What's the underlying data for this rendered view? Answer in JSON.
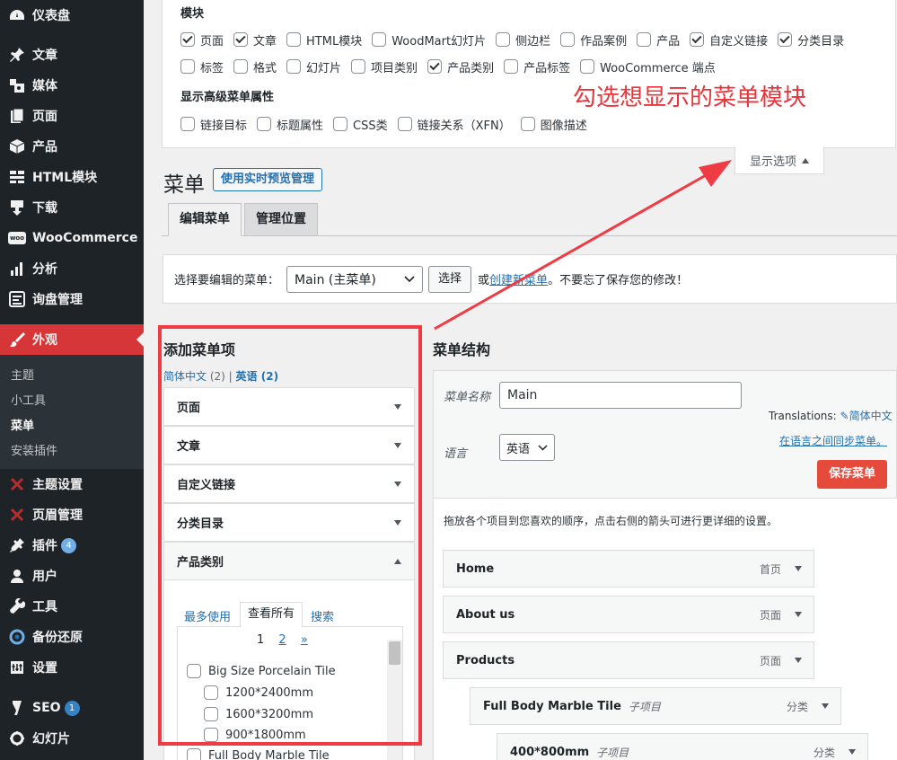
{
  "sidebar": {
    "items": [
      {
        "label": "仪表盘",
        "icon": "dashboard-icon"
      },
      {
        "label": "文章",
        "icon": "pin-icon"
      },
      {
        "label": "媒体",
        "icon": "media-icon"
      },
      {
        "label": "页面",
        "icon": "page-icon"
      },
      {
        "label": "产品",
        "icon": "box-icon"
      },
      {
        "label": "HTML模块",
        "icon": "grid-icon"
      },
      {
        "label": "下载",
        "icon": "download-icon"
      },
      {
        "label": "WooCommerce",
        "icon": "woo-icon"
      },
      {
        "label": "分析",
        "icon": "bar-chart-icon"
      },
      {
        "label": "询盘管理",
        "icon": "inquiry-icon"
      },
      {
        "label": "外观",
        "icon": "brush-icon"
      },
      {
        "label": "主题设置",
        "icon": "x-theme-icon"
      },
      {
        "label": "页眉管理",
        "icon": "x-header-icon"
      },
      {
        "label": "插件",
        "icon": "plugin-icon",
        "badge": "4"
      },
      {
        "label": "用户",
        "icon": "user-icon"
      },
      {
        "label": "工具",
        "icon": "wrench-icon"
      },
      {
        "label": "备份还原",
        "icon": "backup-icon"
      },
      {
        "label": "设置",
        "icon": "settings-icon"
      },
      {
        "label": "SEO",
        "icon": "yoast-icon",
        "badge": "1"
      },
      {
        "label": "幻灯片",
        "icon": "slider-icon"
      }
    ],
    "submenu": [
      "主题",
      "小工具",
      "菜单",
      "安装插件"
    ],
    "woo_logo_text": "woo"
  },
  "screen_options": {
    "modules_heading": "模块",
    "row1": [
      {
        "label": "页面",
        "checked": true
      },
      {
        "label": "文章",
        "checked": true
      },
      {
        "label": "HTML模块",
        "checked": false
      },
      {
        "label": "WoodMart幻灯片",
        "checked": false
      },
      {
        "label": "侧边栏",
        "checked": false
      },
      {
        "label": "作品案例",
        "checked": false
      },
      {
        "label": "产品",
        "checked": false
      },
      {
        "label": "自定义链接",
        "checked": true
      },
      {
        "label": "分类目录",
        "checked": true
      }
    ],
    "row2": [
      {
        "label": "标签",
        "checked": false
      },
      {
        "label": "格式",
        "checked": false
      },
      {
        "label": "幻灯片",
        "checked": false
      },
      {
        "label": "项目类别",
        "checked": false
      },
      {
        "label": "产品类别",
        "checked": true
      },
      {
        "label": "产品标签",
        "checked": false
      },
      {
        "label": "WooCommerce 端点",
        "checked": false
      }
    ],
    "advanced_heading": "显示高级菜单属性",
    "row3": [
      {
        "label": "链接目标",
        "checked": false
      },
      {
        "label": "标题属性",
        "checked": false
      },
      {
        "label": "CSS类",
        "checked": false
      },
      {
        "label": "链接关系（XFN）",
        "checked": false
      },
      {
        "label": "图像描述",
        "checked": false
      }
    ],
    "toggle_label": "显示选项"
  },
  "annotation": "勾选想显示的菜单模块",
  "header": {
    "title": "菜单",
    "live_preview": "使用实时预览管理",
    "tabs": [
      "编辑菜单",
      "管理位置"
    ]
  },
  "select_bar": {
    "prompt": "选择要编辑的菜单：",
    "selected": "Main (主菜单)",
    "select_button": "选择",
    "or_text": "或",
    "create_link": "创建新菜单",
    "reminder": "。不要忘了保存您的修改！"
  },
  "add_items": {
    "title": "添加菜单项",
    "lang_zh": "简体中文",
    "lang_zh_count": "(2)",
    "sep": "|",
    "lang_en": "英语",
    "lang_en_count": "(2)",
    "sections": [
      "页面",
      "文章",
      "自定义链接",
      "分类目录",
      "产品类别"
    ],
    "subtabs": [
      "最多使用",
      "查看所有",
      "搜索"
    ],
    "pager": {
      "current": "1",
      "next_page": "2",
      "next": "»"
    },
    "tree": [
      {
        "label": "Big Size Porcelain Tile",
        "level": 0
      },
      {
        "label": "1200*2400mm",
        "level": 1
      },
      {
        "label": "1600*3200mm",
        "level": 1
      },
      {
        "label": "900*1800mm",
        "level": 1
      },
      {
        "label": "Full Body Marble Tile",
        "level": 0
      }
    ]
  },
  "structure": {
    "title": "菜单结构",
    "name_label": "菜单名称",
    "name_value": "Main",
    "translations_label": "Translations:",
    "translations_link": "简体中文",
    "sync_link": "在语言之间同步菜单。",
    "lang_label": "语言",
    "lang_value": "英语",
    "save_button": "保存菜单",
    "drag_hint": "拖放各个项目到您喜欢的顺序，点击右侧的箭头可进行更详细的设置。",
    "items": [
      {
        "title": "Home",
        "sub": "",
        "type": "首页"
      },
      {
        "title": "About us",
        "sub": "",
        "type": "页面"
      },
      {
        "title": "Products",
        "sub": "",
        "type": "页面"
      },
      {
        "title": "Full Body Marble Tile",
        "sub": "子项目",
        "type": "分类"
      },
      {
        "title": "400*800mm",
        "sub": "子项目",
        "type": "分类"
      }
    ]
  },
  "colors": {
    "sidebar_bg": "#1d2327",
    "active_menu": "#d63638",
    "link": "#2271b1",
    "save_button": "#e64a3b",
    "annotation_red": "#ee3b44"
  }
}
